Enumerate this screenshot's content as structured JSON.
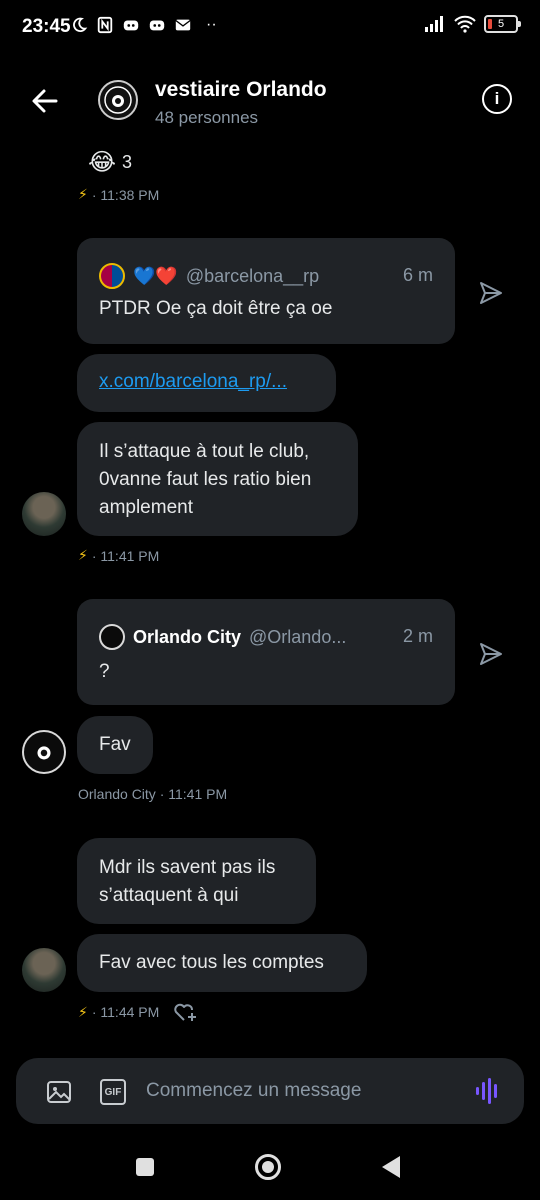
{
  "status_bar": {
    "time": "23:45",
    "battery": "5"
  },
  "header": {
    "title": "vestiaire Orlando",
    "subtitle": "48 personnes"
  },
  "messages": {
    "reaction": {
      "emoji": "😂",
      "count": "3"
    },
    "meta1": "· 11:38 PM",
    "quote1": {
      "hearts": "💙❤️",
      "handle": "@barcelona__rp",
      "time": "6 m",
      "text": "PTDR Oe ça doit être ça oe"
    },
    "link": "x.com/barcelona_rp/...",
    "bubble1": "Il s’attaque à tout le club, 0vanne faut les ratio bien amplement",
    "meta2": "· 11:41 PM",
    "quote2": {
      "name": "Orlando City",
      "handle": "@Orlando...",
      "time": "2 m",
      "text": "?"
    },
    "bubble2": "Fav",
    "meta3": "Orlando City · 11:41 PM",
    "bubble3": "Mdr ils savent pas ils s’attaquent à qui",
    "bubble4": "Fav avec tous les comptes",
    "meta4": "· 11:44 PM"
  },
  "composer": {
    "placeholder": "Commencez un message",
    "gif_label": "GIF"
  },
  "colors": {
    "background": "#000000",
    "bubble": "#202327",
    "link": "#1d9bf0",
    "voice": "#7856ff",
    "bolt": "#f5c518"
  }
}
